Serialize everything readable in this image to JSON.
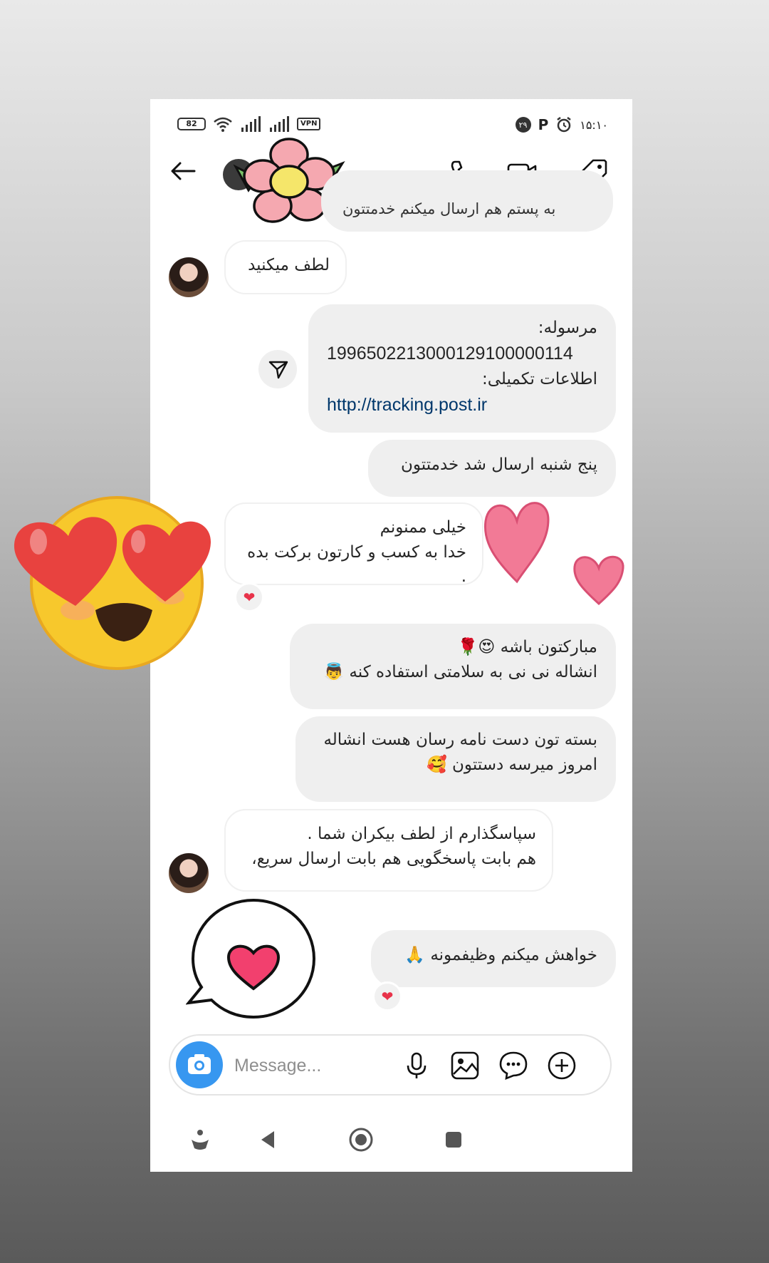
{
  "status_bar": {
    "battery": "82",
    "vpn": "VPN",
    "notification_count": "۲۹",
    "carrier_letter": "P",
    "time": "۱۵:۱۰"
  },
  "header": {
    "back_icon": "arrow-left-icon",
    "call_icon": "phone-icon",
    "video_icon": "video-camera-icon",
    "tag_icon": "tag-icon"
  },
  "messages": [
    {
      "id": "m0",
      "side": "out",
      "text": "به پستم هم ارسال میکنم خدمتتون"
    },
    {
      "id": "m1",
      "side": "in",
      "text": "لطف میکنید"
    },
    {
      "id": "m2",
      "side": "out",
      "lines": [
        "مرسوله:",
        "1996502213000129100000114",
        "اطلاعات تکمیلی:",
        "http://tracking.post.ir"
      ]
    },
    {
      "id": "m3",
      "side": "out",
      "text": "پنج شنبه ارسال شد خدمتتون"
    },
    {
      "id": "m4",
      "side": "in",
      "lines": [
        "خیلی ممنونم",
        "خدا به کسب و کارتون برکت بده ."
      ],
      "reaction": "❤"
    },
    {
      "id": "m5",
      "side": "out",
      "lines": [
        "مبارکتون باشه 😍🌹",
        "انشاله نی نی به سلامتی استفاده کنه 👼"
      ]
    },
    {
      "id": "m6",
      "side": "out",
      "lines": [
        "بسته تون دست نامه رسان هست انشاله",
        "امروز میرسه دستتون 🥰"
      ]
    },
    {
      "id": "m7",
      "side": "in",
      "lines": [
        "سپاسگذارم از لطف بیکران شما .",
        "هم بابت پاسخگویی هم بابت ارسال سریع،"
      ]
    },
    {
      "id": "m8",
      "side": "out",
      "text": "خواهش میکنم وظیفمونه 🙏",
      "reaction": "❤"
    }
  ],
  "composer": {
    "placeholder": "Message...",
    "icons": [
      "camera-icon",
      "microphone-icon",
      "gallery-icon",
      "sticker-chat-icon",
      "plus-circle-icon"
    ]
  },
  "navbar": {
    "icons": [
      "accessibility-icon",
      "nav-back-icon",
      "nav-home-icon",
      "nav-recents-icon"
    ]
  },
  "colors": {
    "accent": "#3797f0",
    "bubble_out": "#efefef",
    "link": "#00376b",
    "heart": "#e8334a"
  }
}
